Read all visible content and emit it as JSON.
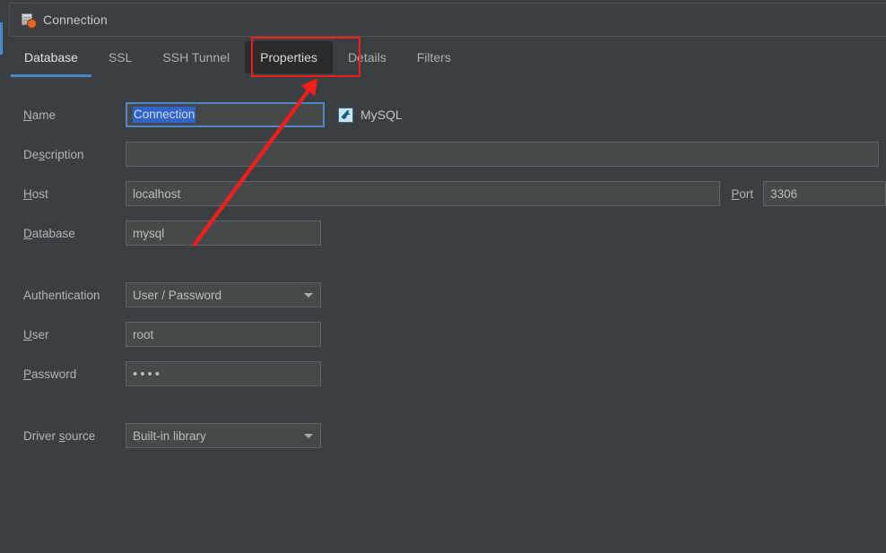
{
  "window": {
    "title": "Connection",
    "icon": "database-connection-icon"
  },
  "tabs": [
    {
      "label": "Database",
      "state": "active"
    },
    {
      "label": "SSL",
      "state": "normal"
    },
    {
      "label": "SSH Tunnel",
      "state": "normal"
    },
    {
      "label": "Properties",
      "state": "hover"
    },
    {
      "label": "Details",
      "state": "normal"
    },
    {
      "label": "Filters",
      "state": "normal"
    }
  ],
  "form": {
    "name": {
      "label_pre": "",
      "label_mnemonic": "N",
      "label_post": "ame",
      "value": "Connection",
      "selected": true,
      "focused": true
    },
    "driver_badge": {
      "label": "MySQL",
      "icon": "mysql-dolphin-icon"
    },
    "description": {
      "label_pre": "De",
      "label_mnemonic": "s",
      "label_post": "cription",
      "value": "",
      "placeholder": ""
    },
    "host": {
      "label_pre": "",
      "label_mnemonic": "H",
      "label_post": "ost",
      "value": "localhost"
    },
    "port": {
      "label_pre": "",
      "label_mnemonic": "P",
      "label_post": "ort",
      "value": "3306"
    },
    "database": {
      "label_pre": "",
      "label_mnemonic": "D",
      "label_post": "atabase",
      "value": "mysql"
    },
    "authentication": {
      "label_pre": "Authentication",
      "label_mnemonic": "",
      "label_post": "",
      "value": "User / Password",
      "options": [
        "User / Password"
      ]
    },
    "user": {
      "label_pre": "",
      "label_mnemonic": "U",
      "label_post": "ser",
      "value": "root"
    },
    "password": {
      "label_pre": "",
      "label_mnemonic": "P",
      "label_post": "assword",
      "value": "••••",
      "masked": true
    },
    "driver_source": {
      "label_pre": "Driver ",
      "label_mnemonic": "s",
      "label_post": "ource",
      "value": "Built-in library",
      "options": [
        "Built-in library"
      ]
    }
  },
  "annotation": {
    "box_target": "Properties",
    "arrow_color": "#fc1c1c",
    "box_color": "#fc1c1c"
  },
  "colors": {
    "panel_bg": "#3c3f41",
    "field_bg": "#45494a",
    "accent": "#4a88c7",
    "selection": "#2f65ca",
    "text": "#bbbbbb"
  }
}
